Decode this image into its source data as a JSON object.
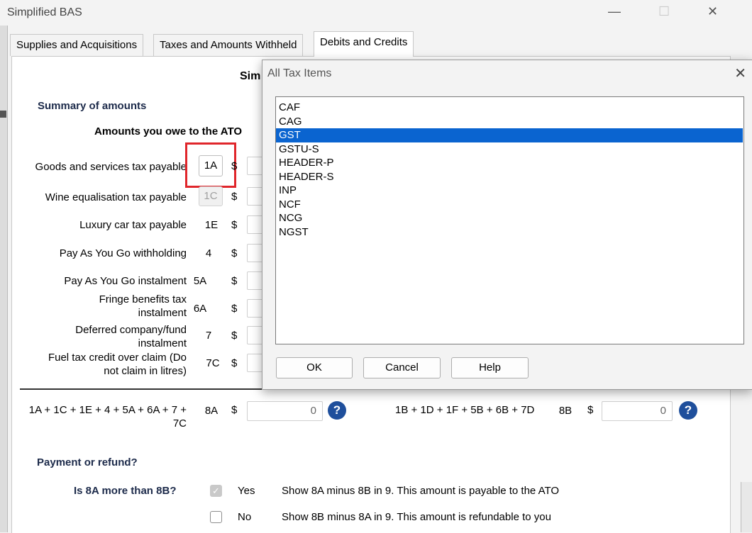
{
  "window": {
    "title": "Simplified BAS",
    "controls": {
      "minimize": "—",
      "maximize": "☐",
      "close": "✕"
    }
  },
  "tabs": [
    {
      "label": "Supplies and Acquisitions"
    },
    {
      "label": "Taxes and Amounts Withheld"
    },
    {
      "label": "Debits and Credits"
    }
  ],
  "form": {
    "heading_partial": "Sim",
    "summary_heading": "Summary of amounts",
    "owe_heading_partial": "Amounts you owe to the ATO",
    "rows": [
      {
        "label": "Goods and services tax payable",
        "code": "1A",
        "currency": "$"
      },
      {
        "label": "Wine equalisation tax payable",
        "code": "1C",
        "currency": "$"
      },
      {
        "label": "Luxury car tax payable",
        "code": "1E",
        "currency": "$"
      },
      {
        "label": "Pay As You Go withholding",
        "code": "4",
        "currency": "$"
      },
      {
        "label": "Pay As You Go instalment",
        "code": "5A",
        "currency": "$"
      },
      {
        "label": "Fringe benefits tax instalment",
        "code": "6A",
        "currency": "$"
      },
      {
        "label": "Deferred company/fund instalment",
        "code": "7",
        "currency": "$"
      },
      {
        "label": "Fuel tax credit over claim (Do not claim in litres)",
        "code": "7C",
        "currency": "$"
      }
    ],
    "total_left": {
      "formula": "1A + 1C + 1E + 4 + 5A + 6A + 7 + 7C",
      "code": "8A",
      "currency": "$",
      "value": "0"
    },
    "total_right": {
      "formula": "1B + 1D + 1F + 5B + 6B + 7D",
      "code": "8B",
      "currency": "$",
      "value": "0"
    },
    "help_glyph": "?",
    "payment_heading": "Payment or refund?",
    "question": "Is 8A more than 8B?",
    "options": [
      {
        "label": "Yes",
        "checked": true,
        "description": "Show 8A minus 8B in 9. This amount is payable to the ATO"
      },
      {
        "label": "No",
        "checked": false,
        "description": "Show 8B minus 8A in 9. This amount is refundable to you"
      }
    ]
  },
  "dialog": {
    "title": "All Tax Items",
    "close": "✕",
    "items": [
      "CAF",
      "CAG",
      "GST",
      "GSTU-S",
      "HEADER-P",
      "HEADER-S",
      "INP",
      "NCF",
      "NCG",
      "NGST"
    ],
    "selected": "GST",
    "buttons": {
      "ok": "OK",
      "cancel": "Cancel",
      "help": "Help"
    }
  },
  "colors": {
    "selection": "#0a64d0",
    "highlight_box": "#e0262b",
    "help_icon": "#1f4f9c"
  }
}
